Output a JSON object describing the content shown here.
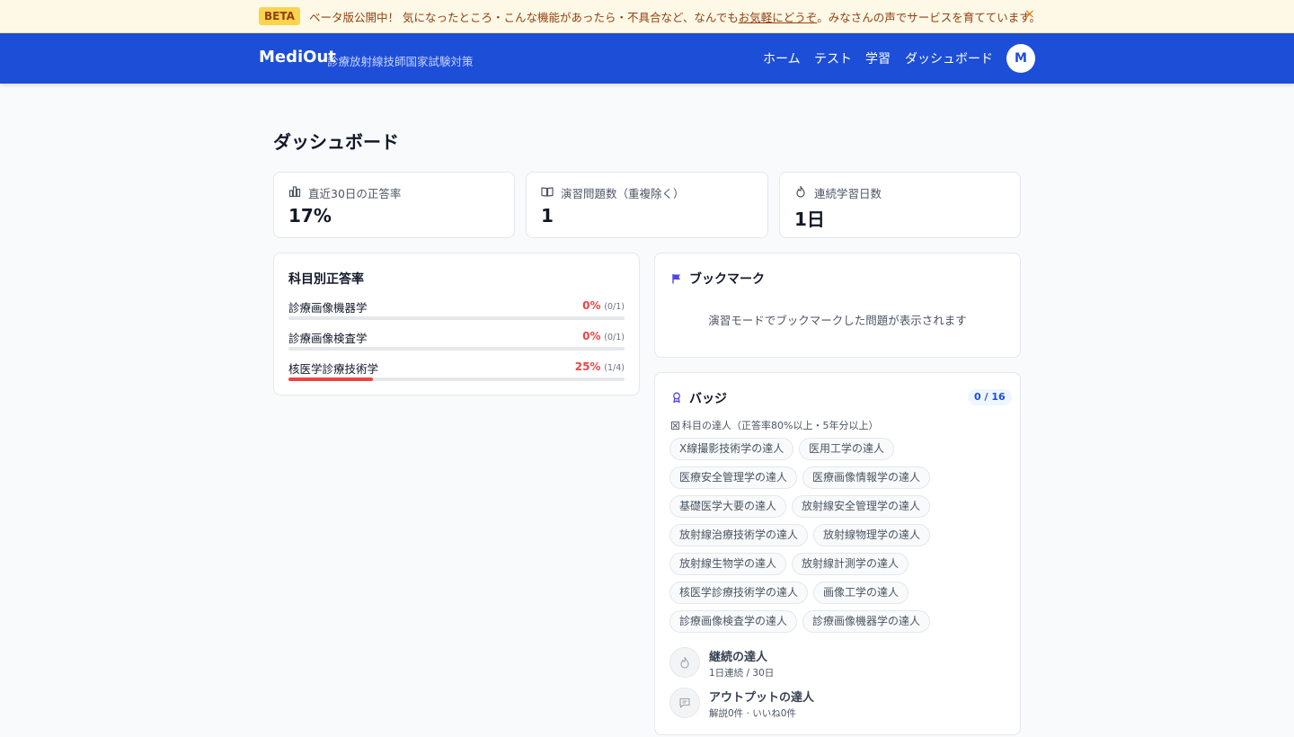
{
  "banner": {
    "badge": "BETA",
    "text_before": "ベータ版公開中！ 気になったところ・こんな機能があったら・不具合など、なんでも",
    "link": "お気軽にどうぞ",
    "text_after": "。みなさんの声でサービスを育てています。",
    "close": "×"
  },
  "header": {
    "logo": "MediOut",
    "subtitle": "診療放射線技師国家試験対策",
    "nav": [
      "ホーム",
      "テスト",
      "学習",
      "ダッシュボード"
    ],
    "avatar": "M",
    "color": "#1d4ed8"
  },
  "page": {
    "title": "ダッシュボード"
  },
  "stats": [
    {
      "icon": "bar-chart-icon",
      "label": "直近30日の正答率",
      "value": "17%"
    },
    {
      "icon": "book-open-icon",
      "label": "演習問題数（重複除く）",
      "value": "1"
    },
    {
      "icon": "flame-icon",
      "label": "連続学習日数",
      "value": "1日"
    }
  ],
  "subjects": {
    "title": "科目別正答率",
    "items": [
      {
        "name": "診療画像機器学",
        "pct": "0%",
        "frac": "(0/1)",
        "ratio": 0
      },
      {
        "name": "診療画像検査学",
        "pct": "0%",
        "frac": "(0/1)",
        "ratio": 0
      },
      {
        "name": "核医学診療技術学",
        "pct": "25%",
        "frac": "(1/4)",
        "ratio": 0.25
      }
    ],
    "accent": "#ef4444"
  },
  "bookmarks": {
    "title": "ブックマーク",
    "empty": "演習モードでブックマークした問題が表示されます"
  },
  "badges": {
    "title": "バッジ",
    "count": "0 / 16",
    "section": "科目の達人（正答率80%以上・5年分以上）",
    "chips": [
      "X線撮影技術学の達人",
      "医用工学の達人",
      "医療安全管理学の達人",
      "医療画像情報学の達人",
      "基礎医学大要の達人",
      "放射線安全管理学の達人",
      "放射線治療技術学の達人",
      "放射線物理学の達人",
      "放射線生物学の達人",
      "放射線計測学の達人",
      "核医学診療技術学の達人",
      "画像工学の達人",
      "診療画像検査学の達人",
      "診療画像機器学の達人"
    ],
    "achievements": [
      {
        "icon": "flame-icon",
        "title": "継続の達人",
        "sub": "1日連続 / 30日"
      },
      {
        "icon": "comment-icon",
        "title": "アウトプットの達人",
        "sub": "解説0件 · いいね0件"
      }
    ]
  }
}
